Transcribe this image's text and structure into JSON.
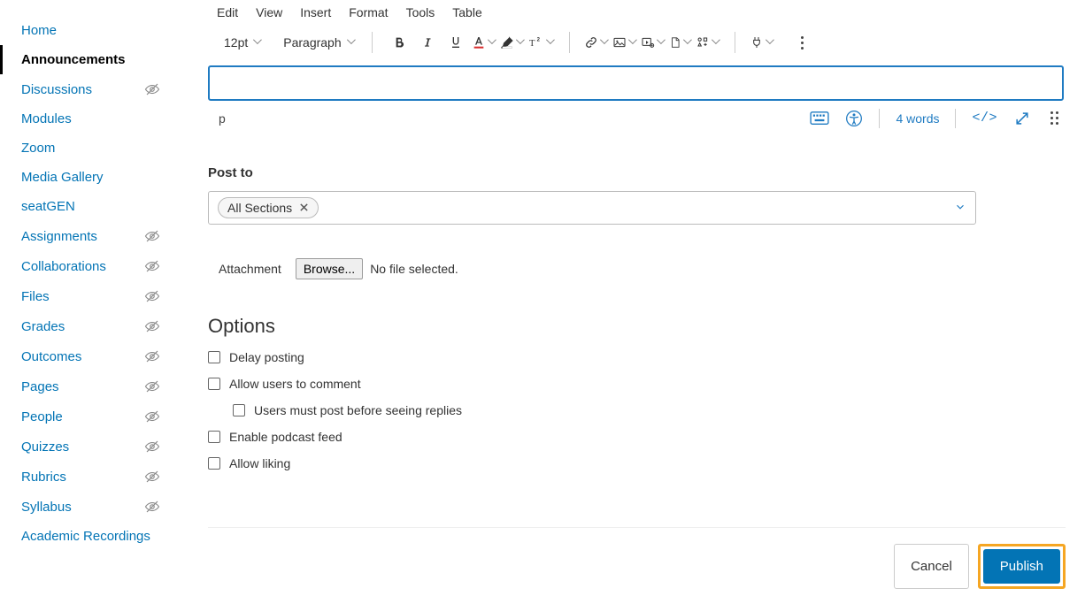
{
  "sidebar": {
    "items": [
      {
        "label": "Home",
        "hidden": false,
        "active": false
      },
      {
        "label": "Announcements",
        "hidden": false,
        "active": true
      },
      {
        "label": "Discussions",
        "hidden": true,
        "active": false
      },
      {
        "label": "Modules",
        "hidden": false,
        "active": false
      },
      {
        "label": "Zoom",
        "hidden": false,
        "active": false
      },
      {
        "label": "Media Gallery",
        "hidden": false,
        "active": false
      },
      {
        "label": "seatGEN",
        "hidden": false,
        "active": false
      },
      {
        "label": "Assignments",
        "hidden": true,
        "active": false
      },
      {
        "label": "Collaborations",
        "hidden": true,
        "active": false
      },
      {
        "label": "Files",
        "hidden": true,
        "active": false
      },
      {
        "label": "Grades",
        "hidden": true,
        "active": false
      },
      {
        "label": "Outcomes",
        "hidden": true,
        "active": false
      },
      {
        "label": "Pages",
        "hidden": true,
        "active": false
      },
      {
        "label": "People",
        "hidden": true,
        "active": false
      },
      {
        "label": "Quizzes",
        "hidden": true,
        "active": false
      },
      {
        "label": "Rubrics",
        "hidden": true,
        "active": false
      },
      {
        "label": "Syllabus",
        "hidden": true,
        "active": false
      },
      {
        "label": "Academic Recordings",
        "hidden": false,
        "active": false
      }
    ]
  },
  "editor": {
    "menus": [
      "Edit",
      "View",
      "Insert",
      "Format",
      "Tools",
      "Table"
    ],
    "font_size": "12pt",
    "block_format": "Paragraph",
    "status_path": "p",
    "word_count": "4 words",
    "code_label": "</>"
  },
  "post_to": {
    "label": "Post to",
    "chip": "All Sections"
  },
  "attachment": {
    "label": "Attachment",
    "browse": "Browse...",
    "status": "No file selected."
  },
  "options": {
    "title": "Options",
    "items": [
      {
        "label": "Delay posting",
        "indent": false
      },
      {
        "label": "Allow users to comment",
        "indent": false
      },
      {
        "label": "Users must post before seeing replies",
        "indent": true
      },
      {
        "label": "Enable podcast feed",
        "indent": false
      },
      {
        "label": "Allow liking",
        "indent": false
      }
    ]
  },
  "footer": {
    "cancel": "Cancel",
    "publish": "Publish"
  }
}
